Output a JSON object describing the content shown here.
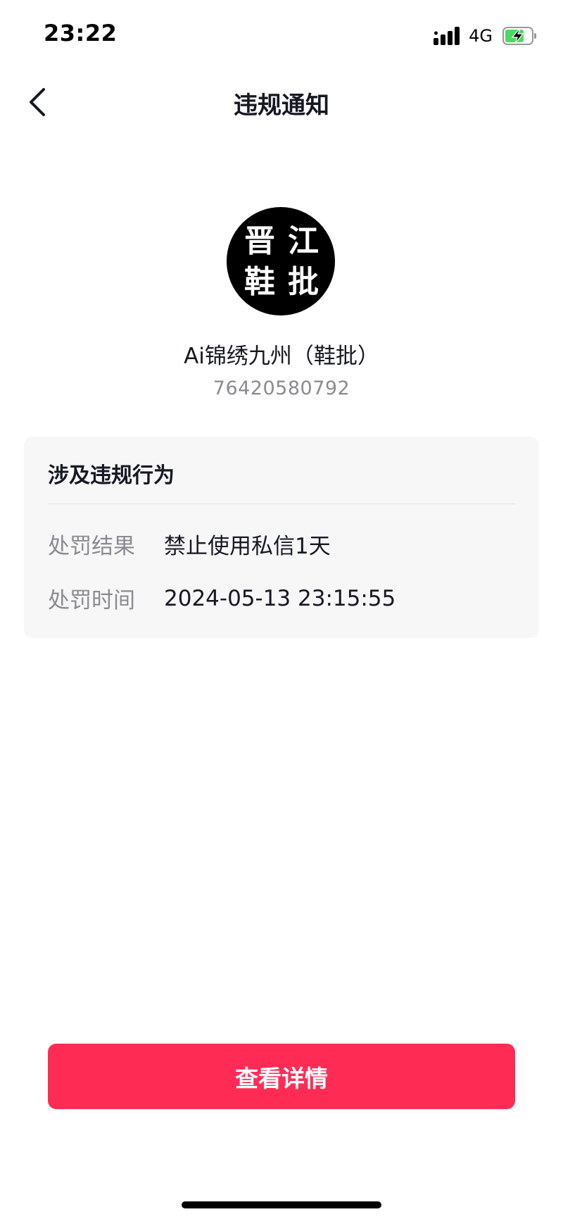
{
  "status_bar": {
    "time": "23:22",
    "network": "4G",
    "icons": {
      "signal": "signal-bars-icon",
      "battery": "battery-charging-icon"
    },
    "battery_color": "#4cd964"
  },
  "nav": {
    "back_icon": "chevron-left-icon",
    "title": "违规通知"
  },
  "account": {
    "avatar_chars": [
      "晋",
      "江",
      "鞋",
      "批"
    ],
    "name": "Ai锦绣九州（鞋批）",
    "id": "76420580792"
  },
  "card": {
    "title": "涉及违规行为",
    "rows": [
      {
        "label": "处罚结果",
        "value": "禁止使用私信1天"
      },
      {
        "label": "处罚时间",
        "value": "2024-05-13 23:15:55"
      }
    ]
  },
  "action": {
    "detail_label": "查看详情",
    "color": "#fe2c55"
  }
}
